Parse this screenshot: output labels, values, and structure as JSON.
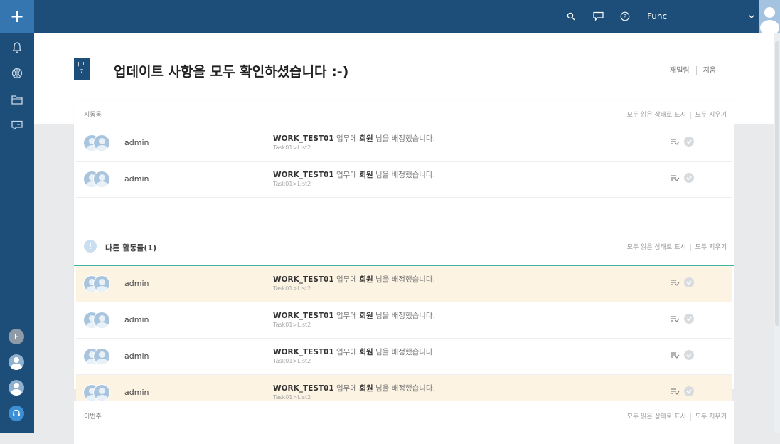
{
  "header": {
    "user_name": "Func",
    "date_month": "JUL",
    "date_day": "7",
    "title": "업데이트 사항을 모두 확인하셨습니다 :-)",
    "link_settings": "재밀림",
    "link_delete": "지움"
  },
  "icons": {
    "sidebar": [
      "plus-icon",
      "bell-icon",
      "globe-icon",
      "folder-icon",
      "chat-icon"
    ],
    "topbar": [
      "search-icon",
      "chat-icon",
      "help-icon",
      "chevron-down-icon"
    ]
  },
  "colors": {
    "sidebar": "#1c4e79",
    "accent": "#3576b0",
    "highlight": "#fdf3e3",
    "divider": "#3eb6a3"
  },
  "sections": [
    {
      "title": "지동동",
      "mark_read": "모두 읽은 상태로 표시",
      "clear_all": "모두 지우기"
    }
  ],
  "other": {
    "icon": "!",
    "title": "다른 활동들(1)",
    "mark_read": "모두 읽은 상태로 표시",
    "clear_all": "모두 지우기"
  },
  "last_section": {
    "title": "이번주",
    "mark_read": "모두 읽은 상태로 표시",
    "clear_all": "모두 지우기"
  },
  "rows": [
    {
      "user": "admin",
      "task": "WORK_TEST01",
      "msg": " 업무에 ",
      "bold": "회원",
      "msg2": " 님을 배정했습니다.",
      "sub": "Task01>List2"
    },
    {
      "user": "admin",
      "task": "WORK_TEST01",
      "msg": " 업무에 ",
      "bold": "회원",
      "msg2": " 님을 배정했습니다.",
      "sub": "Task01>List2"
    },
    {
      "user": "admin",
      "task": "WORK_TEST01",
      "msg": " 업무에 ",
      "bold": "회원",
      "msg2": " 님을 배정했습니다.",
      "sub": "Task01>List2"
    },
    {
      "user": "admin",
      "task": "WORK_TEST01",
      "msg": " 업무에 ",
      "bold": "회원",
      "msg2": " 님을 배정했습니다.",
      "sub": "Task01>List2"
    },
    {
      "user": "admin",
      "task": "WORK_TEST01",
      "msg": " 업무에 ",
      "bold": "회원",
      "msg2": " 님을 배정했습니다.",
      "sub": "Task01>List2"
    },
    {
      "user": "admin",
      "task": "WORK_TEST01",
      "msg": " 업무에 ",
      "bold": "회원",
      "msg2": " 님을 배정했습니다.",
      "sub": "Task01>List2"
    }
  ],
  "sidebar_f": "F"
}
